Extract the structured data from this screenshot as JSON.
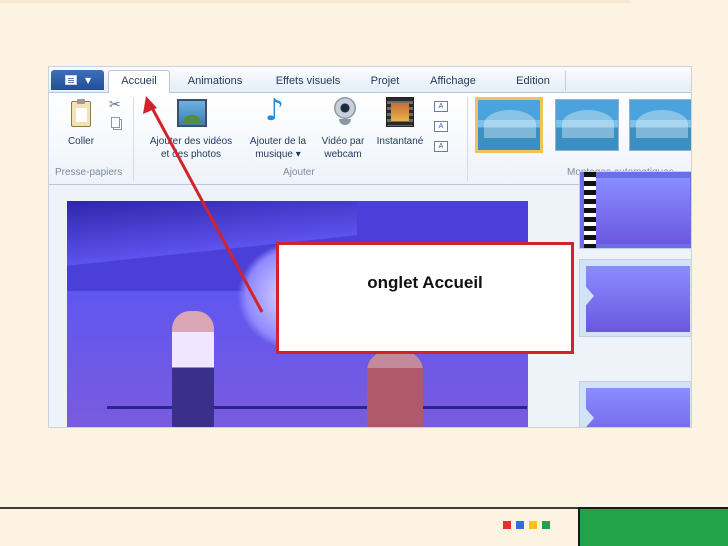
{
  "ribbon": {
    "tabs": [
      "Accueil",
      "Animations",
      "Effets visuels",
      "Projet",
      "Affichage",
      "Edition"
    ],
    "active_tab": "Accueil",
    "commands": {
      "paste": "Coller",
      "add_videos_line1": "Ajouter des vidéos",
      "add_videos_line2": "et des photos",
      "add_music_line1": "Ajouter de la",
      "add_music_line2": "musique ▾",
      "webcam_line1": "Vidéo par",
      "webcam_line2": "webcam",
      "snapshot": "Instantané"
    },
    "groups": {
      "clipboard": "Presse-papiers",
      "add": "Ajouter",
      "autothemes": "Montages automatiques"
    },
    "icons": [
      "file-menu-icon",
      "clipboard-icon",
      "scissors-icon",
      "copy-icon",
      "add-video-icon",
      "music-note-icon",
      "webcam-icon",
      "snapshot-icon",
      "title-icon",
      "caption-icon",
      "credits-icon"
    ]
  },
  "callout": {
    "text": "onglet Accueil",
    "border_color": "#d2232a",
    "arrow_color": "#d2232a"
  },
  "footer": {
    "squares": [
      "#e8302b",
      "#2f6fd6",
      "#f2c41c",
      "#22a34a"
    ],
    "accent": "#22a34a"
  }
}
